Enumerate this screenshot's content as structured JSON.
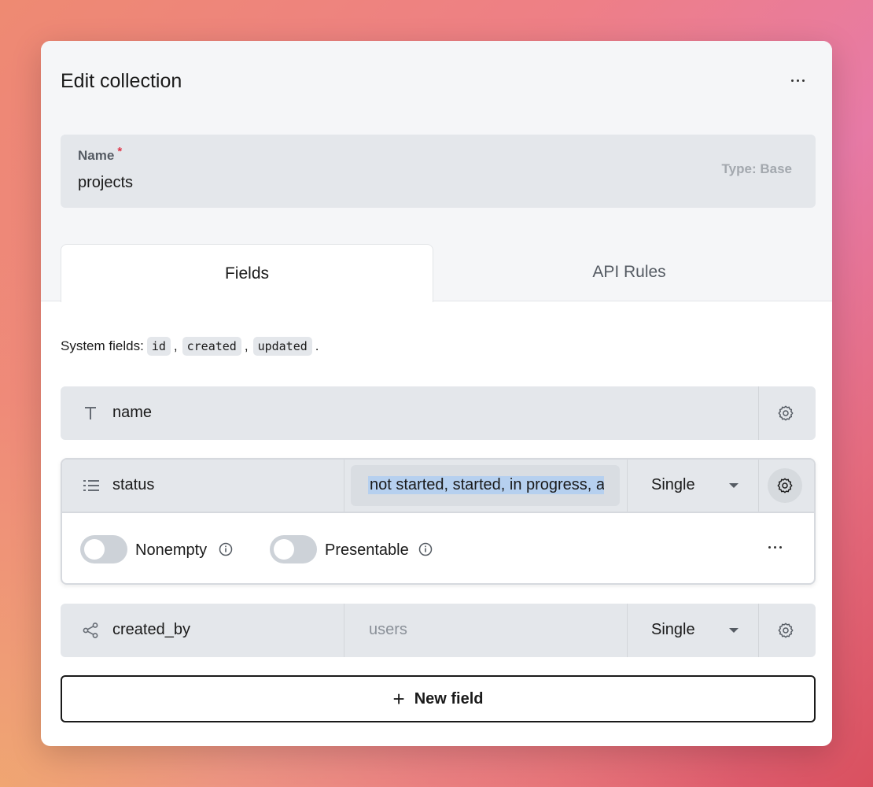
{
  "header": {
    "title": "Edit collection"
  },
  "name_field": {
    "label": "Name",
    "required_mark": "*",
    "value": "projects",
    "type_text": "Type: Base"
  },
  "tabs": [
    {
      "label": "Fields",
      "active": true
    },
    {
      "label": "API Rules",
      "active": false
    }
  ],
  "system_fields": {
    "label": "System fields:",
    "fields": [
      "id",
      "created",
      "updated"
    ],
    "sep": ",",
    "end": "."
  },
  "fields": [
    {
      "name": "name",
      "icon": "text-type-icon"
    },
    {
      "name": "status",
      "icon": "list-icon",
      "values": "not started, started, in progress, a",
      "mode": "Single",
      "options": {
        "nonempty": "Nonempty",
        "presentable": "Presentable"
      }
    },
    {
      "name": "created_by",
      "icon": "relation-icon",
      "collection_placeholder": "users",
      "mode": "Single"
    }
  ],
  "new_field": {
    "icon": "+",
    "label": "New field"
  },
  "colors": {
    "selection": "#b6d0ef",
    "required": "#e0374a"
  }
}
